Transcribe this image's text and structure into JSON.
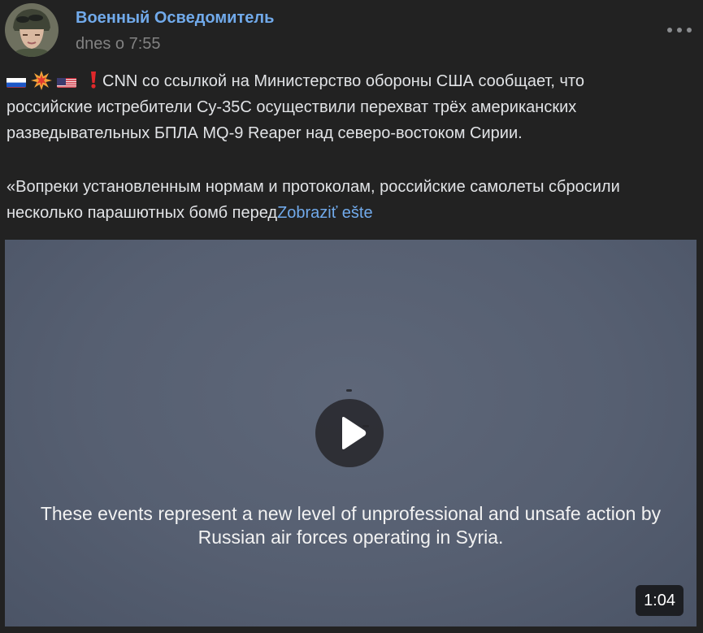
{
  "post": {
    "author": "Военный Осведомитель",
    "timestamp": "dnes o 7:55",
    "avatar_icon": "soldier-avatar",
    "more_icon": "more-dots-icon",
    "text": {
      "emojis": [
        "russia-flag-icon",
        "collision-icon",
        "usa-flag-icon",
        "exclamation-icon"
      ],
      "line1": "CNN со ссылкой на Министерство обороны США сообщает, что",
      "line2": "российские истребители Су-35С осуществили перехват трёх американских",
      "line3": "разведывательных БПЛА MQ-9 Reaper над северо-востоком Сирии.",
      "line4": "«Вопреки установленным нормам и протоколам, российские самолеты сбросили",
      "line5_start": "несколько парашютных бомб перед",
      "show_more": "Zobraziť ešte"
    },
    "video": {
      "caption": "These events represent a new level of unprofessional and unsafe action by\nRussian air forces operating in Syria.",
      "duration": "1:04",
      "play_icon": "play-icon"
    }
  },
  "colors": {
    "background": "#222222",
    "link": "#71aaeb",
    "text": "#e1e3e6",
    "muted": "#828282"
  }
}
